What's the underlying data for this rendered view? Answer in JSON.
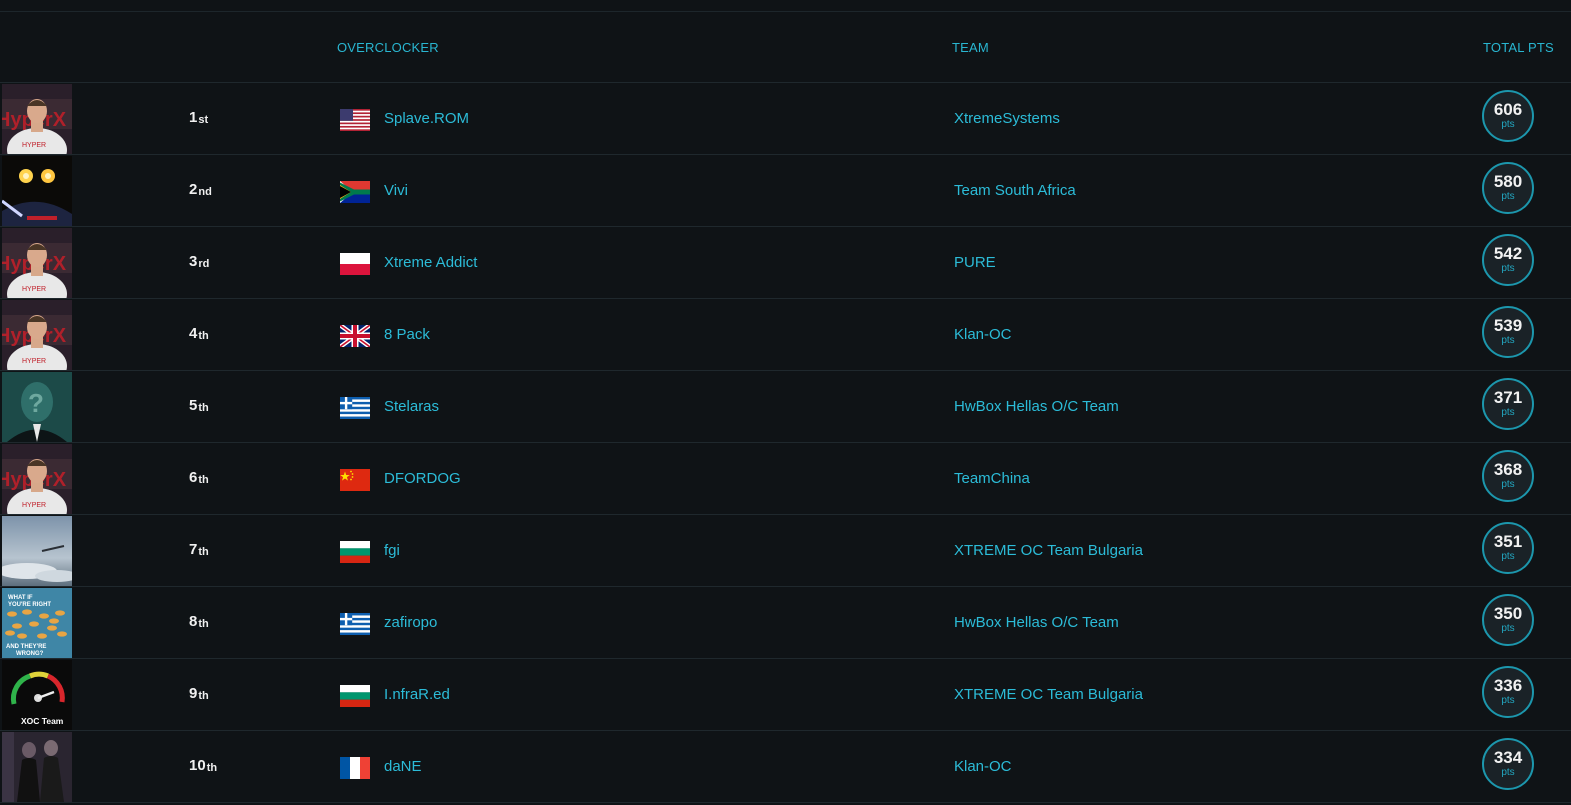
{
  "header": {
    "overclocker": "OVERCLOCKER",
    "team": "TEAM",
    "total_pts": "TOTAL PTS"
  },
  "pts_label": "pts",
  "colors": {
    "accent": "#29b6d1",
    "background": "#0f1316",
    "circle_border": "#1c97ad"
  },
  "rows": [
    {
      "rank_num": "1",
      "rank_suffix": "st",
      "name": "Splave.ROM",
      "team": "XtremeSystems",
      "pts": "606",
      "flag": "us-flag-icon",
      "avatar": "hyperx-person"
    },
    {
      "rank_num": "2",
      "rank_suffix": "nd",
      "name": "Vivi",
      "team": "Team South Africa",
      "pts": "580",
      "flag": "za-flag-icon",
      "avatar": "dark-lights"
    },
    {
      "rank_num": "3",
      "rank_suffix": "rd",
      "name": "Xtreme Addict",
      "team": "PURE",
      "pts": "542",
      "flag": "pl-flag-icon",
      "avatar": "hyperx-person"
    },
    {
      "rank_num": "4",
      "rank_suffix": "th",
      "name": "8 Pack",
      "team": "Klan-OC",
      "pts": "539",
      "flag": "gb-flag-icon",
      "avatar": "hyperx-person"
    },
    {
      "rank_num": "5",
      "rank_suffix": "th",
      "name": "Stelaras",
      "team": "HwBox Hellas O/C Team",
      "pts": "371",
      "flag": "gr-flag-icon",
      "avatar": "question-man"
    },
    {
      "rank_num": "6",
      "rank_suffix": "th",
      "name": "DFORDOG",
      "team": "TeamChina",
      "pts": "368",
      "flag": "cn-flag-icon",
      "avatar": "hyperx-person"
    },
    {
      "rank_num": "7",
      "rank_suffix": "th",
      "name": "fgi",
      "team": "XTREME OC Team Bulgaria",
      "pts": "351",
      "flag": "bg-flag-icon",
      "avatar": "sky"
    },
    {
      "rank_num": "8",
      "rank_suffix": "th",
      "name": "zafiropo",
      "team": "HwBox Hellas O/C Team",
      "pts": "350",
      "flag": "gr-flag-icon",
      "avatar": "fish-poster"
    },
    {
      "rank_num": "9",
      "rank_suffix": "th",
      "name": "I.nfraR.ed",
      "team": "XTREME OC Team Bulgaria",
      "pts": "336",
      "flag": "bg-flag-icon",
      "avatar": "xoc-gauge",
      "avatar_text": "XOC Team"
    },
    {
      "rank_num": "10",
      "rank_suffix": "th",
      "name": "daNE",
      "team": "Klan-OC",
      "pts": "334",
      "flag": "fr-flag-icon",
      "avatar": "dark-figures"
    }
  ]
}
